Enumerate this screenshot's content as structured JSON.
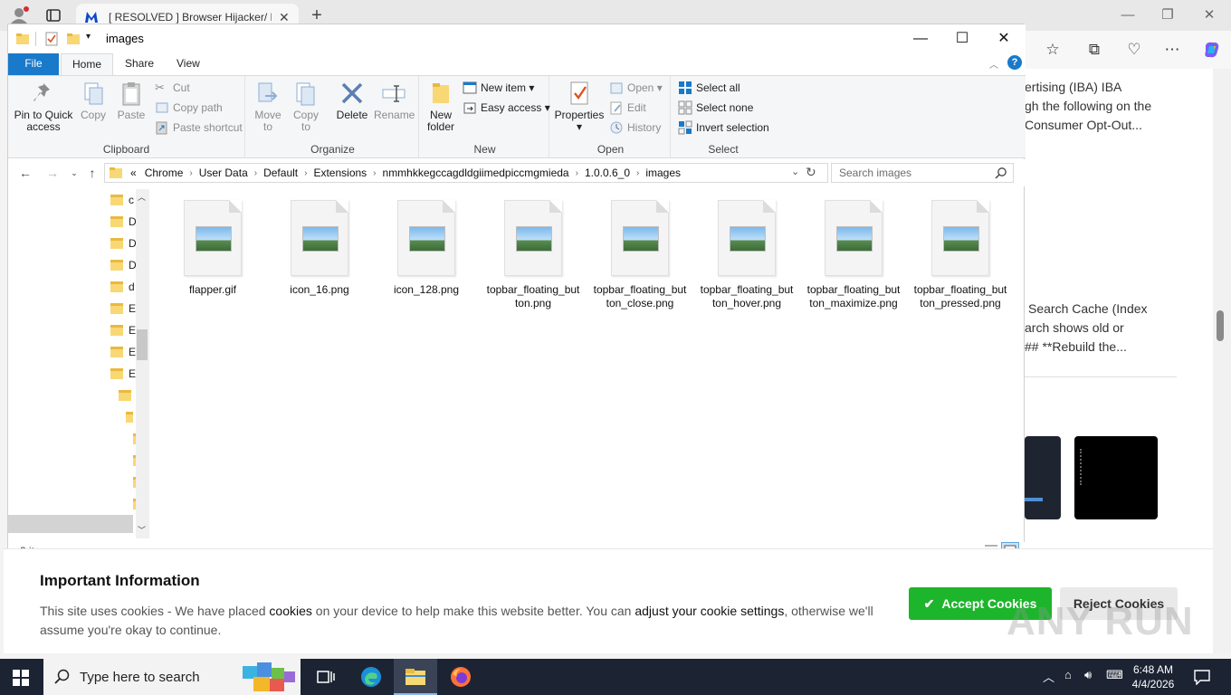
{
  "browser": {
    "tab_title": "[ RESOLVED ] Browser Hijacker/ Po",
    "new_tab": "+",
    "close_tab": "✕"
  },
  "webpage": {
    "top_lines": [
      "ertising (IBA) IBA",
      "gh the following on the",
      "Consumer Opt-Out..."
    ],
    "mid_lines": [
      "Search Cache (Index",
      "arch shows old or",
      "## **Rebuild the..."
    ]
  },
  "explorer": {
    "title": "images",
    "ribbon_tabs": [
      "File",
      "Home",
      "Share",
      "View"
    ],
    "clipboard": {
      "pin": "Pin to Quick access",
      "copy": "Copy",
      "paste": "Paste",
      "cut": "Cut",
      "copy_path": "Copy path",
      "paste_shortcut": "Paste shortcut",
      "label": "Clipboard"
    },
    "organize": {
      "move_to": "Move to",
      "copy_to": "Copy to",
      "delete": "Delete",
      "rename": "Rename",
      "label": "Organize"
    },
    "new": {
      "new_folder": "New folder",
      "new_item": "New item",
      "easy_access": "Easy access",
      "label": "New"
    },
    "open": {
      "properties": "Properties",
      "open": "Open",
      "edit": "Edit",
      "history": "History",
      "label": "Open"
    },
    "select": {
      "select_all": "Select all",
      "select_none": "Select none",
      "invert": "Invert selection",
      "label": "Select"
    },
    "breadcrumb": [
      "Chrome",
      "User Data",
      "Default",
      "Extensions",
      "nmmhkkegccagdldgiimedpiccmgmieda",
      "1.0.0.6_0",
      "images"
    ],
    "breadcrumb_overflow": "«",
    "search_placeholder": "Search images",
    "nav_items": [
      "c",
      "D",
      "D",
      "D",
      "d",
      "E",
      "E",
      "E",
      "E"
    ],
    "files": [
      "flapper.gif",
      "icon_16.png",
      "icon_128.png",
      "topbar_floating_button.png",
      "topbar_floating_button_close.png",
      "topbar_floating_button_hover.png",
      "topbar_floating_button_maximize.png",
      "topbar_floating_button_pressed.png"
    ],
    "status": "8 items"
  },
  "cookie": {
    "title": "Important Information",
    "text_1": "This site uses cookies - We have placed ",
    "link_1": "cookies",
    "text_2": " on your device to help make this website better. You can ",
    "link_2": "adjust your cookie settings",
    "text_3": ", otherwise we'll assume you're okay to continue.",
    "accept": "Accept Cookies",
    "reject": "Reject Cookies"
  },
  "watermark": "ANY RUN",
  "taskbar": {
    "search_label": "Type here to search",
    "time": "6:48 AM",
    "date": "4/4/2026"
  },
  "colors": {
    "accent": "#1979ca",
    "accept_green": "#1db52c",
    "taskbar": "#1c2433"
  }
}
